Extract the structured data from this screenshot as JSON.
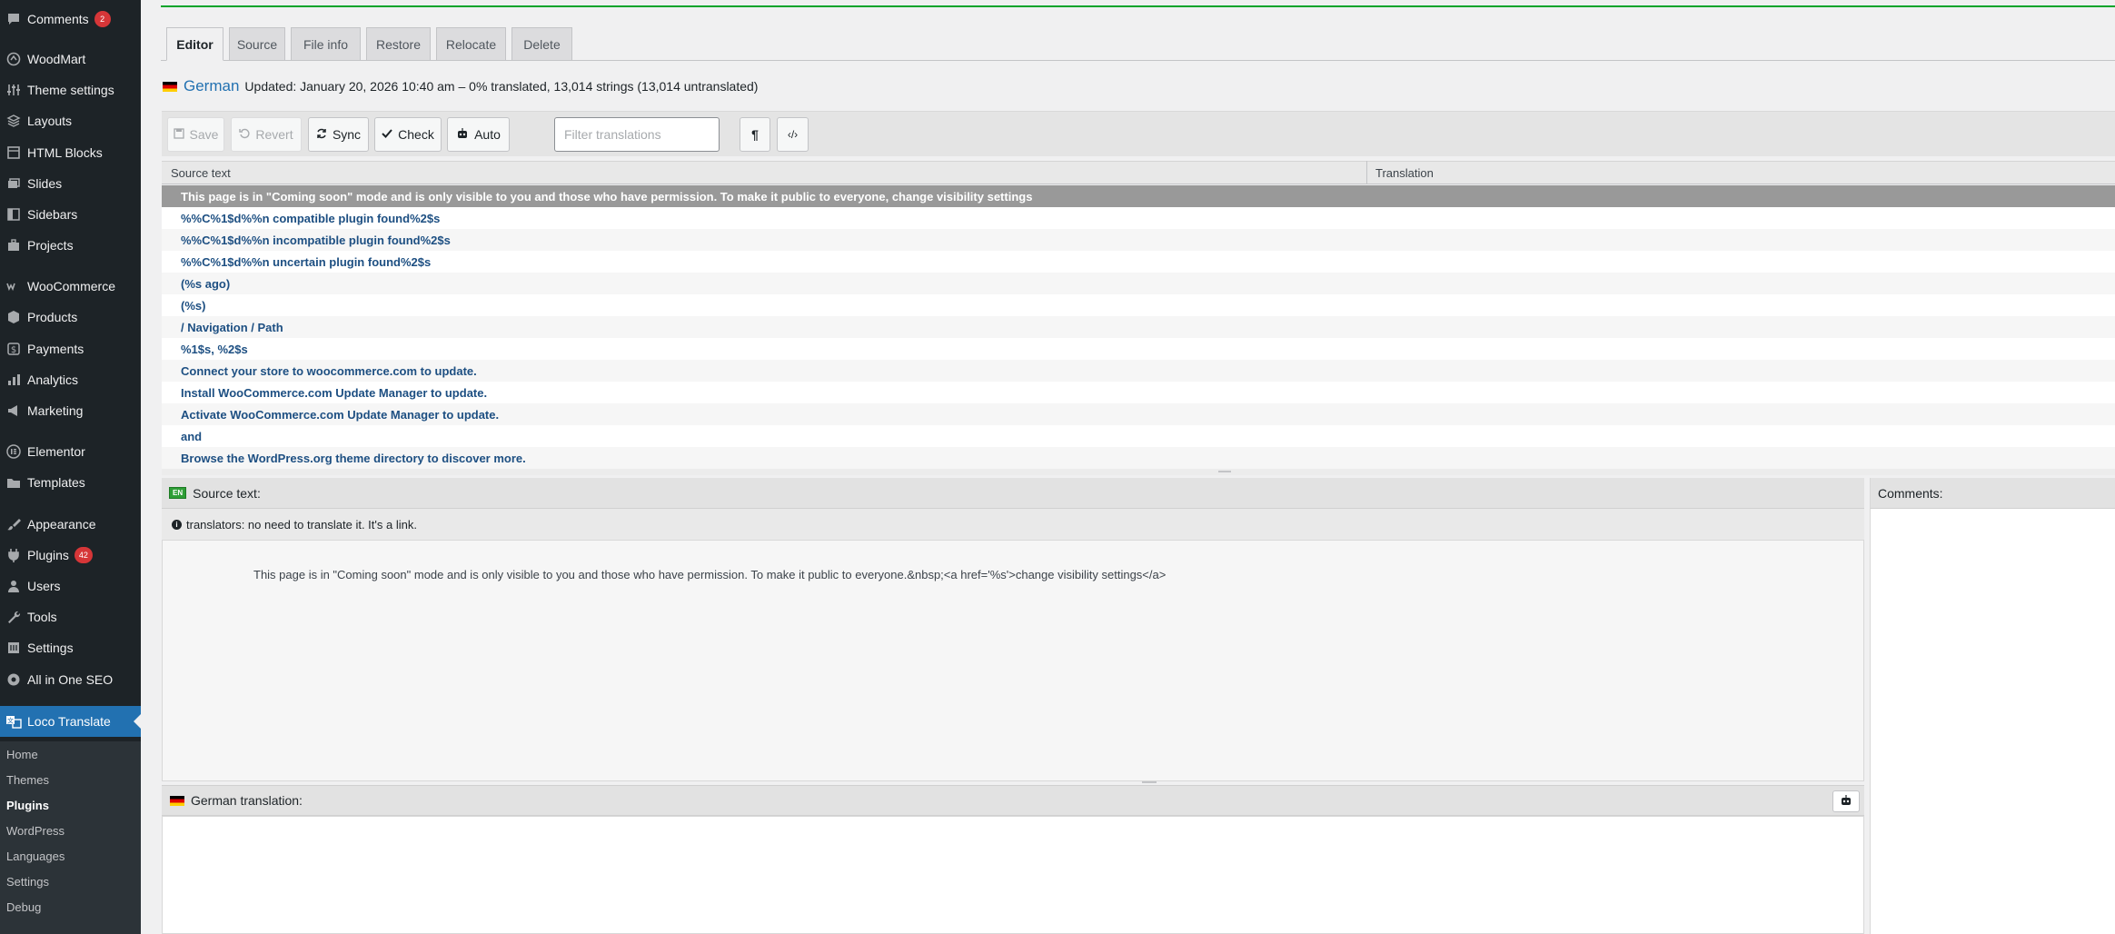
{
  "sidebar": {
    "items": [
      {
        "label": "Comments",
        "icon": "comment-icon",
        "badge": "2"
      },
      {
        "label": "WoodMart",
        "icon": "woodmart-icon",
        "badge": ""
      },
      {
        "label": "Theme settings",
        "icon": "sliders-icon",
        "badge": ""
      },
      {
        "label": "Layouts",
        "icon": "layers-icon",
        "badge": ""
      },
      {
        "label": "HTML Blocks",
        "icon": "blocks-icon",
        "badge": ""
      },
      {
        "label": "Slides",
        "icon": "slides-icon",
        "badge": ""
      },
      {
        "label": "Sidebars",
        "icon": "sidebars-icon",
        "badge": ""
      },
      {
        "label": "Projects",
        "icon": "briefcase-icon",
        "badge": ""
      },
      {
        "label": "WooCommerce",
        "icon": "woo-icon",
        "badge": ""
      },
      {
        "label": "Products",
        "icon": "box-icon",
        "badge": ""
      },
      {
        "label": "Payments",
        "icon": "dollar-icon",
        "badge": ""
      },
      {
        "label": "Analytics",
        "icon": "bar-chart-icon",
        "badge": ""
      },
      {
        "label": "Marketing",
        "icon": "megaphone-icon",
        "badge": ""
      },
      {
        "label": "Elementor",
        "icon": "elementor-icon",
        "badge": ""
      },
      {
        "label": "Templates",
        "icon": "folder-icon",
        "badge": ""
      },
      {
        "label": "Appearance",
        "icon": "brush-icon",
        "badge": ""
      },
      {
        "label": "Plugins",
        "icon": "plug-icon",
        "badge": "42"
      },
      {
        "label": "Users",
        "icon": "user-icon",
        "badge": ""
      },
      {
        "label": "Tools",
        "icon": "wrench-icon",
        "badge": ""
      },
      {
        "label": "Settings",
        "icon": "settings-icon",
        "badge": ""
      },
      {
        "label": "All in One SEO",
        "icon": "seo-icon",
        "badge": ""
      },
      {
        "label": "Loco Translate",
        "icon": "translate-icon",
        "badge": ""
      }
    ],
    "submenu": [
      "Home",
      "Themes",
      "Plugins",
      "WordPress",
      "Languages",
      "Settings",
      "Debug"
    ]
  },
  "tabs": [
    "Editor",
    "Source",
    "File info",
    "Restore",
    "Relocate",
    "Delete"
  ],
  "file": {
    "language": "German",
    "status": "Updated: January 20, 2026 10:40 am – 0% translated, 13,014 strings (13,014 untranslated)"
  },
  "toolbar": {
    "save": "Save",
    "revert": "Revert",
    "sync": "Sync",
    "check": "Check",
    "auto": "Auto",
    "filter_placeholder": "Filter translations",
    "pilcrow": "¶",
    "code": "‹/›"
  },
  "table": {
    "headers": [
      "Source text",
      "Translation"
    ],
    "rows": [
      "This page is in \"Coming soon\" mode and is only visible to you and those who have permission. To make it public to everyone, change visibility settings",
      "%%C%1$d%%n compatible plugin found%2$s",
      "%%C%1$d%%n incompatible plugin found%2$s",
      "%%C%1$d%%n uncertain plugin found%2$s",
      "(%s ago)",
      "(%s)",
      "/ Navigation / Path",
      "%1$s, %2$s",
      "Connect your store to woocommerce.com to update.",
      "Install WooCommerce.com Update Manager to update.",
      "Activate WooCommerce.com Update Manager to update.",
      "and",
      "Browse the WordPress.org theme directory to discover more."
    ]
  },
  "source_pane": {
    "badge": "EN",
    "title": "Source text:",
    "note": "translators: no need to translate it. It's a link.",
    "text": "This page is in \"Coming soon\" mode and is only visible to you and those who have permission. To make it public to everyone.&nbsp;<a href='%s'>change visibility settings</a>"
  },
  "comments_pane": {
    "title": "Comments:"
  },
  "translation_pane": {
    "title": "German translation:"
  }
}
